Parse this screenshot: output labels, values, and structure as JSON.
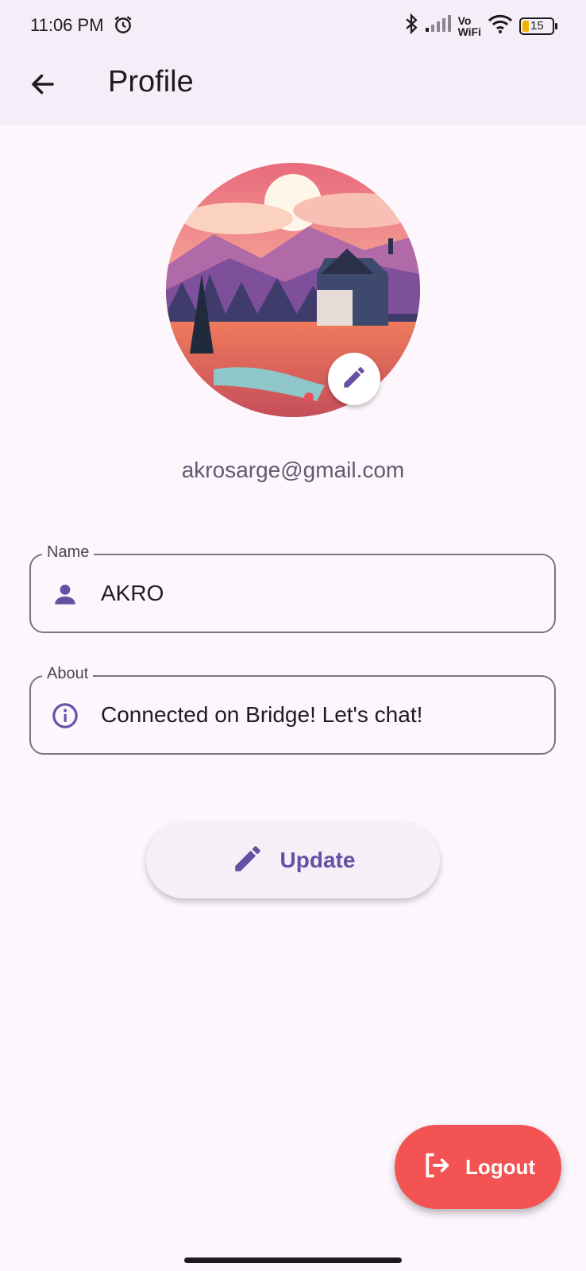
{
  "status": {
    "time": "11:06 PM",
    "volte": "Vo",
    "wifi": "WiFi",
    "battery": "15"
  },
  "appbar": {
    "title": "Profile"
  },
  "profile": {
    "email": "akrosarge@gmail.com"
  },
  "fields": {
    "name": {
      "label": "Name",
      "value": "AKRO"
    },
    "about": {
      "label": "About",
      "value": "Connected on Bridge! Let's chat!"
    }
  },
  "actions": {
    "update_label": "Update",
    "logout_label": "Logout"
  },
  "colors": {
    "accent": "#6750a4",
    "logout": "#f45353",
    "background": "#fdf6fd",
    "appbar": "#f3eef8"
  },
  "icons": {
    "back": "arrow-back-icon",
    "edit_photo": "pencil-icon",
    "name": "person-icon",
    "about": "info-icon",
    "update": "pencil-icon",
    "logout": "logout-icon"
  }
}
